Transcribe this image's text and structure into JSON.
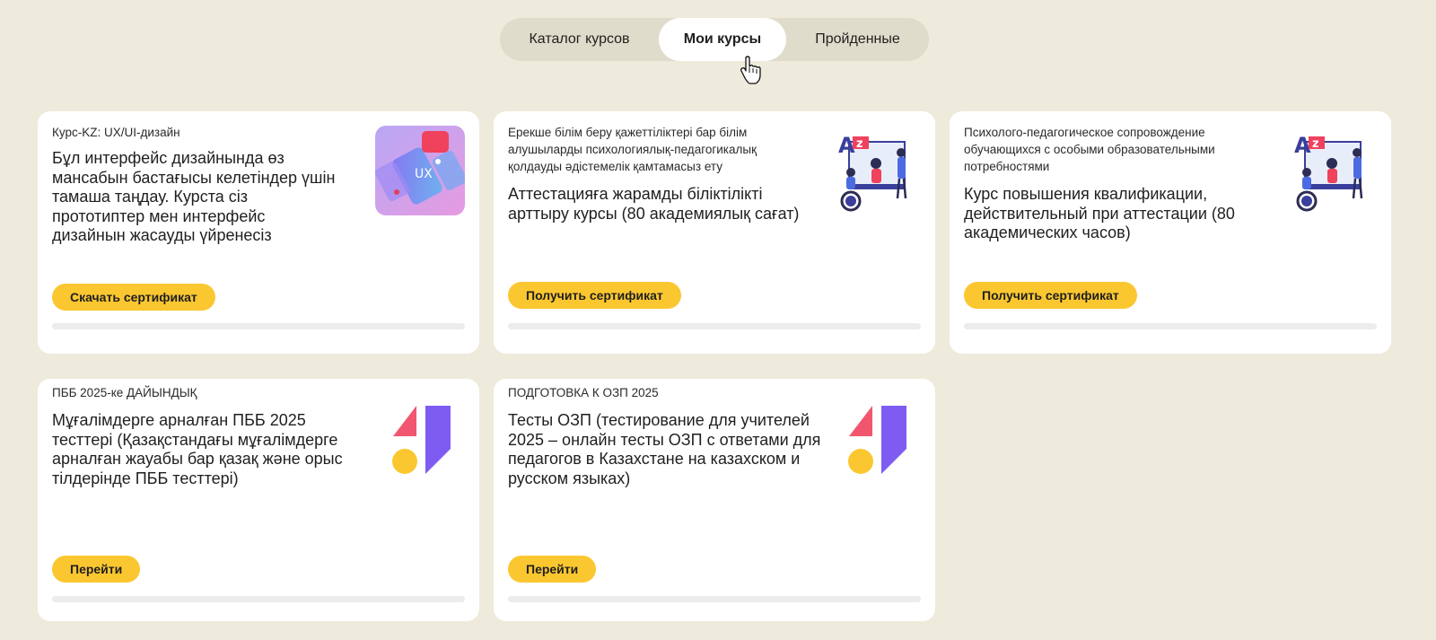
{
  "tabs": [
    {
      "label": "Каталог курсов",
      "active": false
    },
    {
      "label": "Мои курсы",
      "active": true
    },
    {
      "label": "Пройденные",
      "active": false
    }
  ],
  "colors": {
    "accent": "#fbc730",
    "background": "#efebdc",
    "card": "#ffffff"
  },
  "courses": [
    {
      "category": "Курс-KZ: UX/UI-дизайн",
      "title": "Бұл интерфейс дизайнында өз мансабын бастағысы келетіндер үшін тамаша таңдау. Курста сіз прототиптер мен интерфейс дизайнын жасауды үйренесіз",
      "button": "Скачать сертификат",
      "icon": "ux-ui-phone-illustration",
      "progress": 0
    },
    {
      "category": "Ерекше білім беру қажеттіліктері бар білім алушыларды психологиялық-педагогикалық қолдауды әдістемелік қамтамасыз ету",
      "title": "Аттестацияға жарамды біліктілікті арттыру курсы (80 академиялық сағат)",
      "button": "Получить сертификат",
      "icon": "classroom-illustration",
      "progress": 0
    },
    {
      "category": "Психолого-педагогическое сопровождение обучающихся с особыми образовательными потребностями",
      "title": "Курс повышения квалификации, действительный при аттестации (80 академических часов)",
      "button": "Получить сертификат",
      "icon": "classroom-illustration",
      "progress": 0
    },
    {
      "category": "ПББ 2025-ке ДАЙЫНДЫҚ",
      "title": "Мұғалімдерге арналған ПББ 2025 тесттері (Қазақстандағы мұғалімдерге арналған жауабы бар қазақ және орыс тілдерінде ПББ тесттері)",
      "button": "Перейти",
      "icon": "brand-shapes-logo",
      "progress": 0
    },
    {
      "category": "ПОДГОТОВКА К ОЗП 2025",
      "title": "Тесты ОЗП (тестирование для учителей 2025 – онлайн тесты ОЗП с ответами для педагогов в Казахстане на казахском и русском языках)",
      "button": "Перейти",
      "icon": "brand-shapes-logo",
      "progress": 0
    }
  ]
}
